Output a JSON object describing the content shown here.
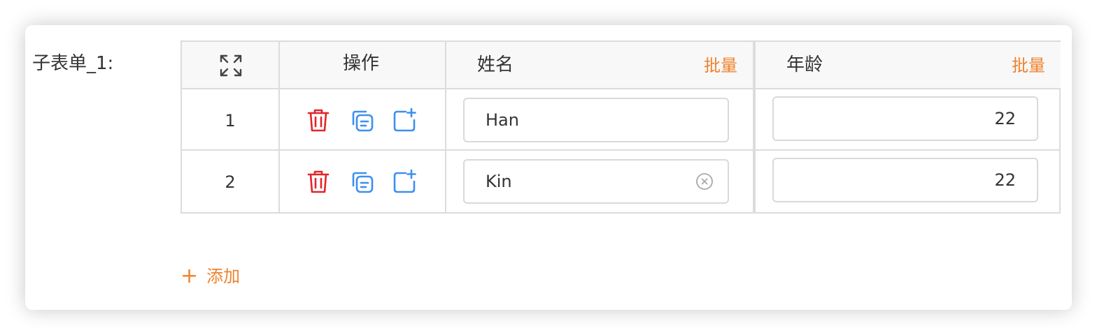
{
  "form": {
    "label": "子表单_1:"
  },
  "table": {
    "headers": {
      "expand_icon": "expand-icon",
      "actions": "操作",
      "name": "姓名",
      "age": "年龄",
      "batch": "批量"
    },
    "rows": [
      {
        "index": "1",
        "name": "Han",
        "age": "22"
      },
      {
        "index": "2",
        "name": "Kin",
        "age": "22"
      }
    ],
    "row_actions": [
      "delete-icon",
      "copy-icon",
      "insert-icon"
    ]
  },
  "add_button": {
    "icon": "+",
    "label": "添加"
  },
  "colors": {
    "accent": "#f0822d",
    "delete": "#e0262b",
    "action_blue": "#3d8ff0",
    "border": "#dcdcdc",
    "header_bg": "#f8f8f8"
  }
}
